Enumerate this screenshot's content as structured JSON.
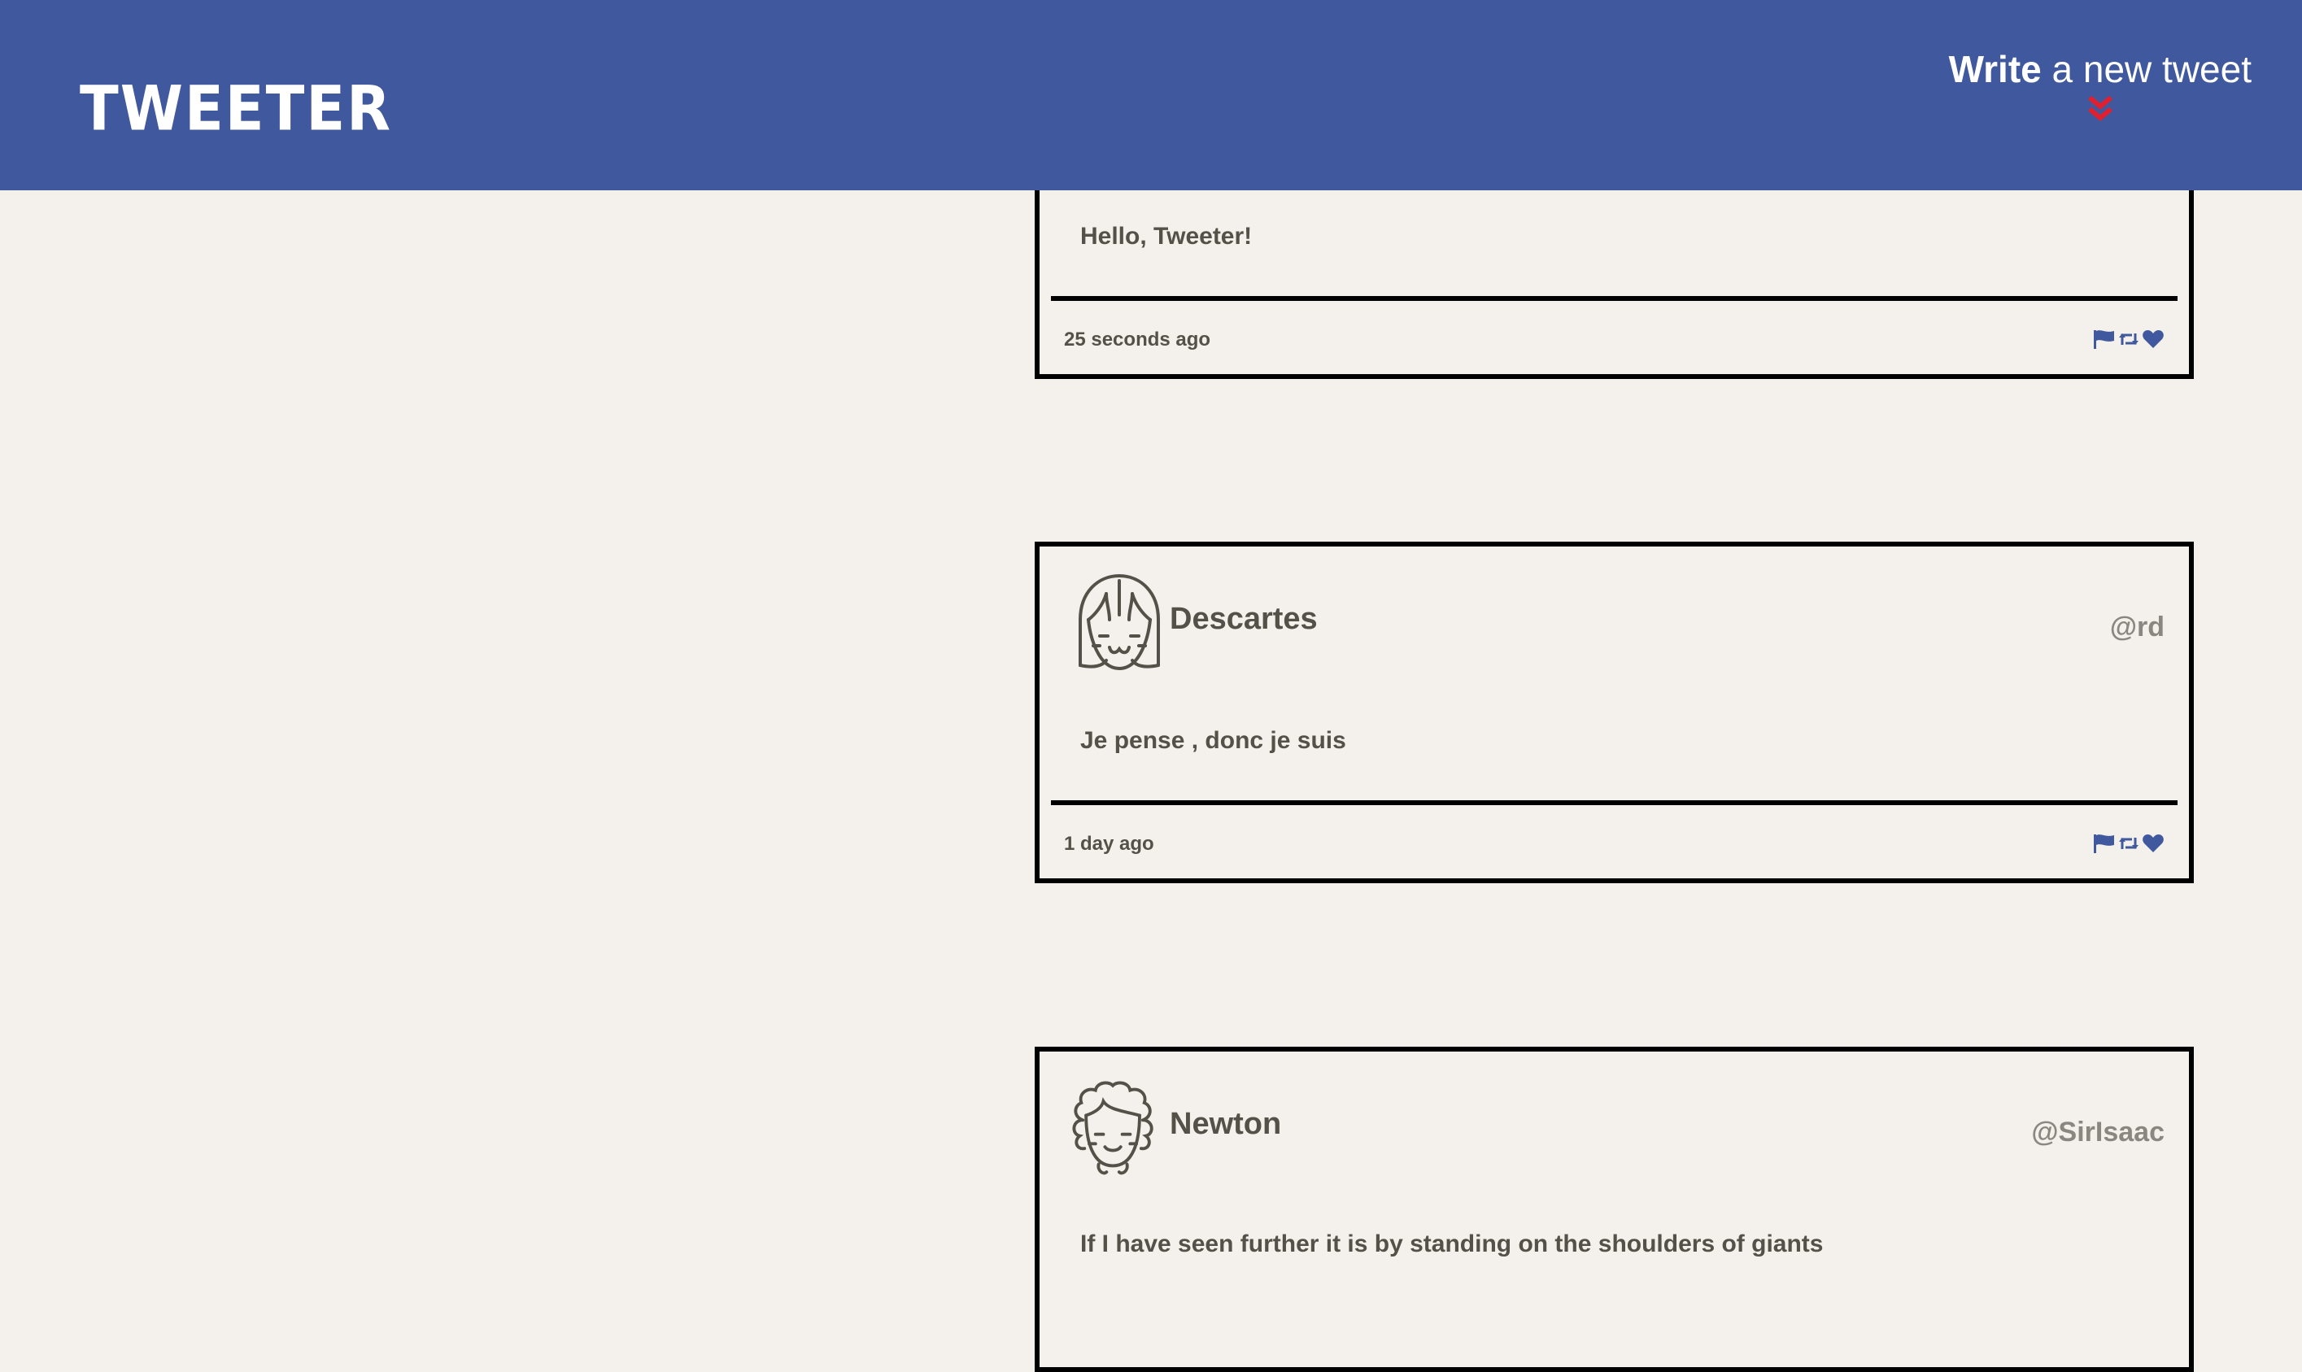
{
  "app": {
    "logo": "TWEETER"
  },
  "compose": {
    "label_bold": "Write",
    "label_rest": "a new tweet",
    "arrow_icon": "double-chevron-down-icon",
    "arrow_color": "#e0202e"
  },
  "colors": {
    "header_bg": "#40589e",
    "page_bg": "#f4f1ec",
    "action_icon": "#40589e",
    "text": "#545149",
    "handle": "#8a8781"
  },
  "tweets": [
    {
      "author": "",
      "handle": "",
      "text": "Hello, Tweeter!",
      "time": "25 seconds ago",
      "actions": [
        "flag-icon",
        "retweet-icon",
        "heart-icon"
      ]
    },
    {
      "author": "Descartes",
      "handle": "@rd",
      "text": "Je pense , donc je suis",
      "time": "1 day ago",
      "avatar": "girl-face-avatar",
      "actions": [
        "flag-icon",
        "retweet-icon",
        "heart-icon"
      ]
    },
    {
      "author": "Newton",
      "handle": "@SirIsaac",
      "text": "If I have seen further it is by standing on the shoulders of giants",
      "avatar": "curly-hair-face-avatar"
    }
  ]
}
